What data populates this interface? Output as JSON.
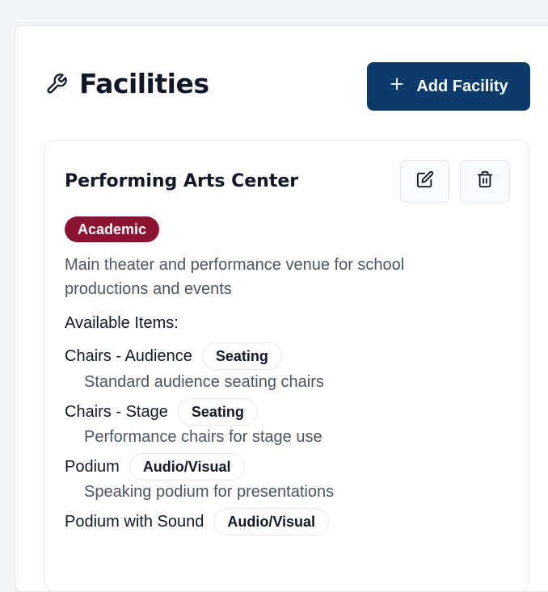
{
  "header": {
    "title": "Facilities",
    "add_button_label": "Add Facility"
  },
  "facility": {
    "name": "Performing Arts Center",
    "category": "Academic",
    "category_color": "#8b1230",
    "description_line1": "Main theater and performance venue for school",
    "description_line2": "productions and events",
    "items_heading": "Available Items:",
    "items": [
      {
        "name": "Chairs - Audience",
        "tag": "Seating",
        "description": "Standard audience seating chairs"
      },
      {
        "name": "Chairs - Stage",
        "tag": "Seating",
        "description": "Performance chairs for stage use"
      },
      {
        "name": "Podium",
        "tag": "Audio/Visual",
        "description": "Speaking podium for presentations"
      },
      {
        "name": "Podium with Sound",
        "tag": "Audio/Visual"
      }
    ]
  },
  "colors": {
    "primary_button": "#0b3a6b",
    "background": "#f3f4f6"
  },
  "icons": {
    "title_icon": "wrench-icon",
    "add_icon": "plus-icon",
    "edit_icon": "edit-icon",
    "delete_icon": "trash-icon"
  }
}
